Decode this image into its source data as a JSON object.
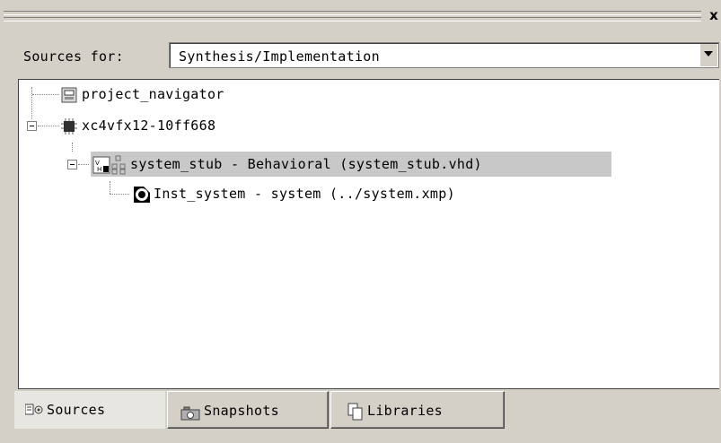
{
  "header": {
    "close_label": "x"
  },
  "sources_for": {
    "label": "Sources for:",
    "value": "Synthesis/Implementation"
  },
  "tree": {
    "nodes": [
      {
        "label": "project_navigator",
        "icon": "project-icon"
      },
      {
        "label": "xc4vfx12-10ff668",
        "icon": "chip-icon"
      },
      {
        "label": "system_stub - Behavioral (system_stub.vhd)",
        "icon": "vhdl-module-icon",
        "selected": true
      },
      {
        "label": "Inst_system - system (../system.xmp)",
        "icon": "xmp-system-icon"
      }
    ]
  },
  "tabs": [
    {
      "label": "Sources",
      "icon": "sources-icon",
      "active": true
    },
    {
      "label": "Snapshots",
      "icon": "camera-icon",
      "active": false
    },
    {
      "label": "Libraries",
      "icon": "libraries-icon",
      "active": false
    }
  ]
}
